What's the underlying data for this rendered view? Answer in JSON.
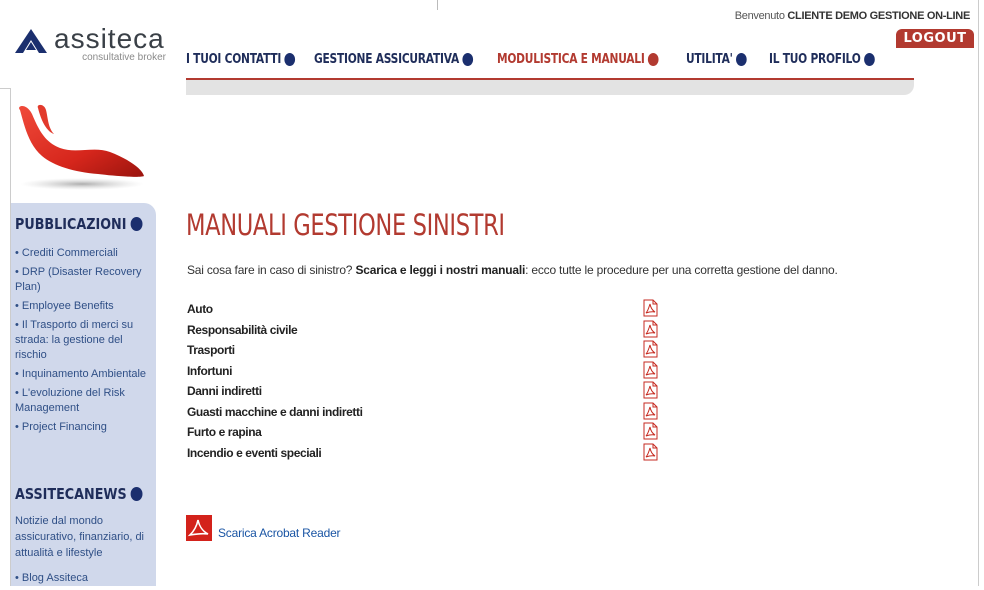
{
  "brand": {
    "name": "assiteca",
    "tagline": "consultative broker"
  },
  "header": {
    "welcome_prefix": "Benvenuto",
    "welcome_user": "CLIENTE DEMO GESTIONE ON-LINE",
    "logout_label": "LOGOUT"
  },
  "nav": {
    "items": [
      {
        "label": "I TUOI CONTATTI"
      },
      {
        "label": "GESTIONE ASSICURATIVA"
      },
      {
        "label": "MODULISTICA E MANUALI"
      },
      {
        "label": "UTILITA'"
      },
      {
        "label": "IL TUO PROFILO"
      }
    ]
  },
  "sidebar": {
    "pubblicazioni_title": "PUBBLICAZIONI",
    "pubblicazioni": [
      "• Crediti Commerciali",
      "• DRP (Disaster Recovery Plan)",
      "• Employee Benefits",
      "• Il Trasporto di merci su strada: la gestione del rischio",
      "• Inquinamento Ambientale",
      "• L'evoluzione del Risk Management",
      "• Project Financing"
    ],
    "news_title": "ASSITECANEWS",
    "news_note": "Notizie dal mondo assicurativo, finanziario, di attualità e lifestyle",
    "news_items": [
      "• Blog Assiteca"
    ]
  },
  "main": {
    "title": "MANUALI GESTIONE SINISTRI",
    "intro_prefix": "Sai cosa fare in caso di sinistro?",
    "intro_bold": "Scarica e leggi i nostri manuali",
    "intro_suffix": ": ecco tutte le procedure per una corretta gestione del danno.",
    "manuals": [
      {
        "label": "Auto"
      },
      {
        "label": "Responsabilità civile"
      },
      {
        "label": "Trasporti"
      },
      {
        "label": "Infortuni"
      },
      {
        "label": "Danni indiretti"
      },
      {
        "label": "Guasti macchine e danni indiretti"
      },
      {
        "label": "Furto e rapina"
      },
      {
        "label": "Incendio e eventi speciali"
      }
    ],
    "acrobat_label": "Scarica Acrobat Reader"
  },
  "colors": {
    "accent_red": "#b23a30",
    "navy": "#1b2f6e",
    "sidebar_bg": "#d0d8eb",
    "link_blue": "#1a55a4"
  },
  "icons": {
    "nav_bullet": "dot-icon",
    "manual_download": "pdf-icon",
    "acrobat": "acrobat-icon"
  }
}
